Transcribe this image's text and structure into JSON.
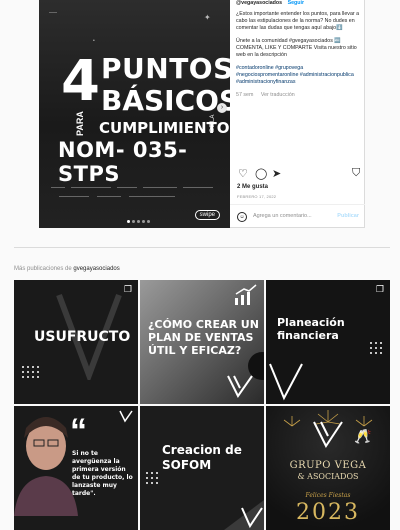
{
  "post": {
    "slide": {
      "big_number": "4",
      "line1": "PUNTOS",
      "line2": "BÁSICOS",
      "para": "PARA",
      "line3": "CUMPLIMIENTO",
      "de_la": "DE LA",
      "line4": "NOM- 035- STPS",
      "swipe": "swipe"
    },
    "caption": {
      "username": "@vegayasociados",
      "follow": "Seguir",
      "p1": "¿Estos importante entender los puntos, para llevar a cabo las estipulaciones de la norma? No dudes en comentar las dudas que tengas aquí abajo⬇️",
      "p2": "Únete a la comunidad #gvegayasociados 🔤 COMENTA, LIKE Y COMPARTE Visita nuestro sitio web en la descripción",
      "tags": "#contadoronline #grupovega #negociospromentaronline #administracionpublica #administracionyfinanzas",
      "time": "57 sem",
      "translate": "Ver traducción"
    },
    "likes": "2 Me gusta",
    "date": "FEBRERO 17, 2022",
    "comment_placeholder": "Agrega un comentario...",
    "publish": "Publicar"
  },
  "more": {
    "prefix": "Más publicaciones de",
    "user": "gvegayasociados"
  },
  "tiles": {
    "t1": "USUFRUCTO",
    "t2": "¿CÓMO CREAR UN PLAN DE VENTAS ÚTIL Y EFICAZ?",
    "t3_1": "Planeación",
    "t3_2": "financiera",
    "t4": "Si no te avergüenza la primera versión de tu producto, lo lanzaste muy tarde\".",
    "t5_1": "Creacion de",
    "t5_2": "SOFOM",
    "t6_1": "GRUPO VEGA",
    "t6_2": "& ASOCIADOS",
    "t6_3": "Felices Fiestas",
    "t6_4": "2023"
  }
}
